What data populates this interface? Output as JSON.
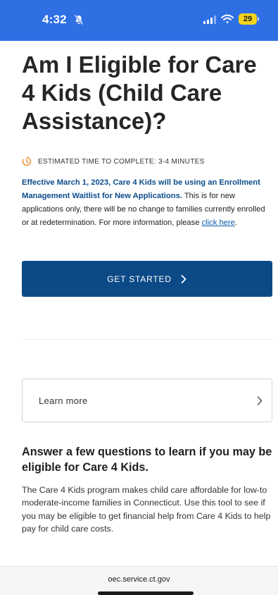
{
  "status_bar": {
    "time": "4:32",
    "battery": "29",
    "bg_color": "#2f6fe4",
    "battery_color": "#f5d31c",
    "icons": [
      "bell-slash-icon",
      "signal-icon",
      "wifi-icon",
      "battery-icon"
    ]
  },
  "page": {
    "title": "Am I Eligible for Care 4 Kids (Child Care Assistance)?",
    "estimated_time": "ESTIMATED TIME TO COMPLETE: 3-4 MINUTES",
    "notice_bold": "Effective March 1, 2023, Care 4 Kids will be using an Enrollment Management Waitlist for New Applications.",
    "notice_text": " This is for new applications only, there will be no change to families currently enrolled or at redetermination. For more information, please ",
    "notice_link": "click here",
    "notice_end": ".",
    "get_started_label": "GET STARTED",
    "learn_more_label": "Learn more",
    "section_heading": "Answer a few questions to learn if you may be eligible for Care 4 Kids.",
    "section_body": "The Care 4 Kids program makes child care affordable for low-to moderate-income families in Connecticut. Use this tool to see if you may be eligible to get financial help from Care 4 Kids to help pay for child care costs."
  },
  "colors": {
    "primary_button": "#0c4a87",
    "notice_heading": "#0b4d8c",
    "link": "#0b5cab",
    "timer_icon": "#f28c28"
  },
  "browser": {
    "url": "oec.service.ct.gov"
  }
}
